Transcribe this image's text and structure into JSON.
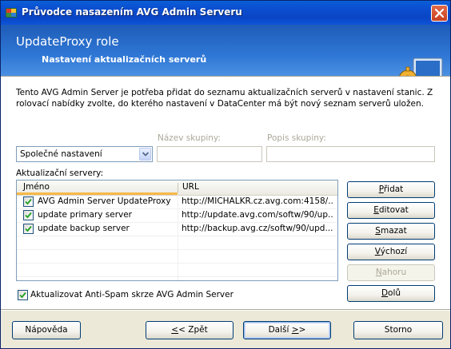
{
  "window": {
    "title": "Průvodce nasazením AVG Admin Serveru"
  },
  "banner": {
    "title": "UpdateProxy role",
    "subtitle": "Nastavení aktualizačních serverů"
  },
  "description": "Tento AVG Admin Server je potřeba přidat do seznamu aktualizačních serverů v nastavení stanic. Z rolovací nabídky zvolte, do kterého nastavení v DataCenter má být nový seznam serverů uložen.",
  "settings": {
    "group_name_label": "Název skupiny:",
    "group_desc_label": "Popis skupiny:",
    "combo_value": "Společné nastavení",
    "group_name_value": "",
    "group_desc_value": ""
  },
  "servers": {
    "label": "Aktualizační servery:",
    "columns": {
      "name": "Jméno",
      "url": "URL"
    },
    "rows": [
      {
        "checked": true,
        "name": "AVG Admin Server UpdateProxy",
        "url": "http://MICHALKR.cz.avg.com:4158/..."
      },
      {
        "checked": true,
        "name": "update primary server",
        "url": "http://update.avg.com/softw/90/up..."
      },
      {
        "checked": true,
        "name": "update backup server",
        "url": "http://backup.avg.cz/softw/90/upd..."
      }
    ]
  },
  "side_buttons": {
    "add": {
      "pre": "",
      "u": "P",
      "post": "řidat"
    },
    "edit": {
      "pre": "",
      "u": "E",
      "post": "ditovat"
    },
    "delete": {
      "pre": "",
      "u": "S",
      "post": "mazat"
    },
    "default": {
      "pre": "",
      "u": "V",
      "post": "ýchozí"
    },
    "up": {
      "pre": "",
      "u": "N",
      "post": "ahoru"
    },
    "down": {
      "pre": "",
      "u": "D",
      "post": "olů"
    }
  },
  "antispam": {
    "checked": true,
    "label": "Aktualizovat Anti-Spam skrze AVG Admin Server"
  },
  "footer": {
    "help": "Nápověda",
    "back": {
      "pre": "",
      "u": "<",
      "post": "< Zpět"
    },
    "next": {
      "pre": "Další ",
      "u": ">",
      "post": ">"
    },
    "cancel": "Storno"
  },
  "colors": {
    "title_bar": "#0a4fd0",
    "banner": "#2f77d5",
    "header_sort_accent": "#f6b94a"
  },
  "icons": [
    "avg-app-icon",
    "close-icon",
    "gear-monitor-icon",
    "dropdown-arrow-icon",
    "checkmark-icon"
  ]
}
